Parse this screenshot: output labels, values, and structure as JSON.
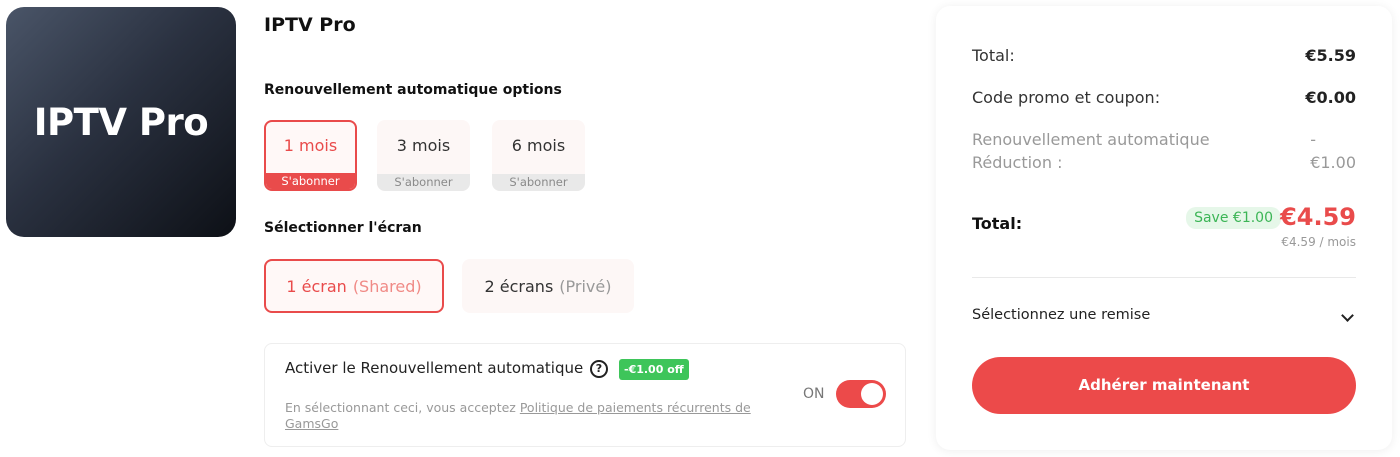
{
  "product": {
    "logo_text": "IPTV Pro",
    "title": "IPTV Pro"
  },
  "renewal": {
    "title": "Renouvellement automatique options",
    "options": [
      {
        "label": "1 mois",
        "sub": "S'abonner",
        "selected": true
      },
      {
        "label": "3 mois",
        "sub": "S'abonner",
        "selected": false
      },
      {
        "label": "6 mois",
        "sub": "S'abonner",
        "selected": false
      }
    ]
  },
  "screen": {
    "title": "Sélectionner l'écran",
    "options": [
      {
        "label": "1 écran",
        "hint": "(Shared)",
        "selected": true
      },
      {
        "label": "2 écrans",
        "hint": "(Privé)",
        "selected": false
      }
    ]
  },
  "auto_renew": {
    "title": "Activer le Renouvellement automatique",
    "help_icon": "question-circle-icon",
    "badge": "-€1.00 off",
    "note_prefix": "En sélectionnant ceci, vous acceptez ",
    "note_link": "Politique de paiements récurrents de GamsGo",
    "toggle_label": "ON",
    "enabled": true
  },
  "summary": {
    "total_label": "Total:",
    "total_value": "€5.59",
    "promo_label": "Code promo et coupon:",
    "promo_value": "€0.00",
    "auto_label_line1": "Renouvellement automatique",
    "auto_label_line2": "Réduction :",
    "auto_value_line1": "-",
    "auto_value_line2": "€1.00",
    "final_label": "Total:",
    "save_badge": "Save  €1.00",
    "final_value": "€4.59",
    "per_month": "€4.59 / mois",
    "discount_select": "Sélectionnez une remise",
    "cta": "Adhérer maintenant"
  },
  "colors": {
    "accent": "#e94b4b",
    "success": "#3ec55a"
  }
}
